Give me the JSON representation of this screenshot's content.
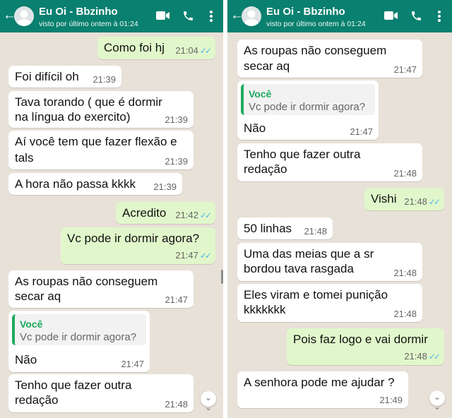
{
  "chat": {
    "contact_name": "Eu Oi - Bbzinho",
    "last_seen": "visto por último ontem à 01:24"
  },
  "icons": {
    "back": "arrow-left-icon",
    "video": "video-camera-icon",
    "call": "phone-icon",
    "menu": "more-vertical-icon",
    "scroll": "chevron-double-down-icon",
    "read": "double-check-icon"
  },
  "colors": {
    "header": "#0a8070",
    "chat_background": "#e8e1d8",
    "incoming_bubble": "#ffffff",
    "outgoing_bubble": "#e1f7cb",
    "read_ticks": "#4fb5e8",
    "quote_accent": "#1daa61"
  },
  "left_messages": [
    {
      "text": "Como foi hj",
      "time": "21:04",
      "ticks": "✓✓"
    },
    {
      "text": "Foi difícil oh",
      "time": "21:39"
    },
    {
      "line1": "Tava torando ( que é dormir",
      "line2": "na língua do exercito)",
      "time": "21:39"
    },
    {
      "line1": "Aí você tem que fazer flexão e",
      "line2": "tals",
      "time": "21:39"
    },
    {
      "text": "A hora não passa kkkk",
      "time": "21:39"
    },
    {
      "text": "Acredito",
      "time": "21:42",
      "ticks": "✓✓"
    },
    {
      "text": "Vc pode ir dormir agora?",
      "time": "21:47",
      "ticks": "✓✓"
    },
    {
      "line1": "As roupas não conseguem",
      "line2": "secar aq",
      "time": "21:47"
    },
    {
      "quote_author": "Você",
      "quote_text": "Vc pode ir dormir agora?",
      "text": "Não",
      "time": "21:47"
    },
    {
      "line1": "Tenho que fazer outra",
      "line2": "redação",
      "time": "21:48"
    }
  ],
  "right_messages": [
    {
      "line1": "As roupas não conseguem",
      "line2": "secar aq",
      "time": "21:47"
    },
    {
      "quote_author": "Você",
      "quote_text": "Vc pode ir dormir agora?",
      "text": "Não",
      "time": "21:47"
    },
    {
      "line1": "Tenho que fazer outra",
      "line2": "redação",
      "time": "21:48"
    },
    {
      "text": "Vishi",
      "time": "21:48",
      "ticks": "✓✓"
    },
    {
      "text": "50 linhas",
      "time": "21:48"
    },
    {
      "line1": "Uma das meias que a sr",
      "line2": "bordou tava rasgada",
      "time": "21:48"
    },
    {
      "line1": "Eles viram e tomei punição",
      "line2": "kkkkkkk",
      "time": "21:48"
    },
    {
      "text": "Pois faz logo e vai dormir",
      "time": "21:48",
      "ticks": "✓✓"
    },
    {
      "text": "A senhora pode me ajudar ?",
      "time": "21:49"
    }
  ]
}
